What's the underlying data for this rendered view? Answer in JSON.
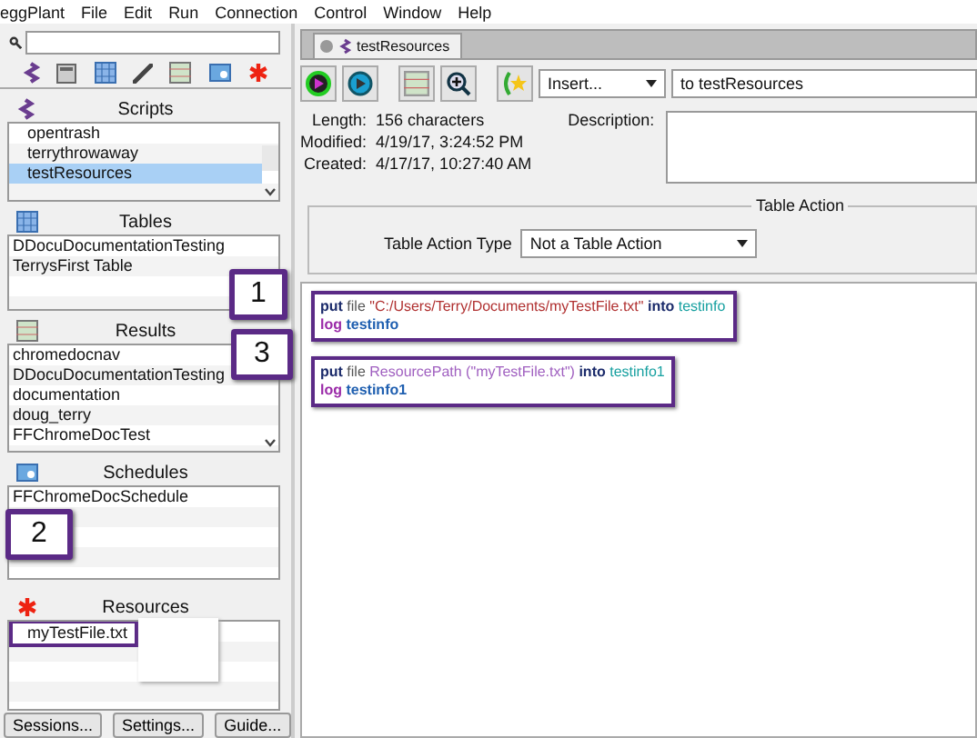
{
  "menu": [
    "eggPlant",
    "File",
    "Edit",
    "Run",
    "Connection",
    "Control",
    "Window",
    "Help"
  ],
  "sections": [
    {
      "title": "Scripts",
      "scrollbar": true,
      "items": [
        {
          "label": "opentrash",
          "selected": false
        },
        {
          "label": "terrythrowaway",
          "selected": false
        },
        {
          "label": "testResources",
          "selected": true
        }
      ]
    },
    {
      "title": "Tables",
      "items": [
        {
          "label": "DDocuDocumentationTesting",
          "selected": false
        },
        {
          "label": "TerrysFirst Table",
          "selected": false
        }
      ]
    },
    {
      "title": "Results",
      "scrollbar": true,
      "items": [
        {
          "label": "chromedocnav",
          "selected": false
        },
        {
          "label": "DDocuDocumentationTesting",
          "selected": false
        },
        {
          "label": "documentation",
          "selected": false
        },
        {
          "label": "doug_terry",
          "selected": false
        },
        {
          "label": "FFChromeDocTest",
          "selected": false
        }
      ]
    },
    {
      "title": "Schedules",
      "items": [
        {
          "label": "FFChromeDocSchedule",
          "selected": false
        }
      ]
    },
    {
      "title": "Resources",
      "items": [
        {
          "label": "myTestFile.txt",
          "selected": false,
          "highlighted": true
        }
      ]
    }
  ],
  "buttons": [
    "Sessions...",
    "Settings...",
    "Guide..."
  ],
  "tab": {
    "title": "testResources"
  },
  "insert": {
    "value": "Insert..."
  },
  "target": "to testResources",
  "info": [
    {
      "label": "Length:",
      "value": "156 characters"
    },
    {
      "label": "Modified:",
      "value": "4/19/17, 3:24:52 PM"
    },
    {
      "label": "Created:",
      "value": "4/17/17, 10:27:40 AM"
    }
  ],
  "description_label": "Description:",
  "table_action": {
    "group_title": "Table Action",
    "label": "Table Action Type",
    "value": "Not a Table Action"
  },
  "code_blocks": [
    {
      "highlighted": true,
      "lines": [
        [
          {
            "kind": "keyword",
            "text": "put"
          },
          {
            "kind": "plain",
            "text": "file"
          },
          {
            "kind": "string",
            "text": "\"C:/Users/Terry/Documents/myTestFile.txt\""
          },
          {
            "kind": "keyword",
            "text": "into"
          },
          {
            "kind": "variable",
            "text": "testinfo"
          }
        ],
        [
          {
            "kind": "command",
            "text": "log"
          },
          {
            "kind": "identifier",
            "text": "testinfo"
          }
        ]
      ]
    },
    {
      "highlighted": true,
      "lines": [
        [
          {
            "kind": "keyword",
            "text": "put"
          },
          {
            "kind": "plain",
            "text": "file"
          },
          {
            "kind": "function",
            "text": "ResourcePath (\"myTestFile.txt\")"
          },
          {
            "kind": "keyword",
            "text": "into"
          },
          {
            "kind": "variable",
            "text": "testinfo1"
          }
        ],
        [
          {
            "kind": "command",
            "text": "log"
          },
          {
            "kind": "identifier",
            "text": "testinfo1"
          }
        ]
      ]
    }
  ],
  "callouts": [
    {
      "text": "1"
    },
    {
      "text": "3"
    },
    {
      "text": "2"
    }
  ]
}
